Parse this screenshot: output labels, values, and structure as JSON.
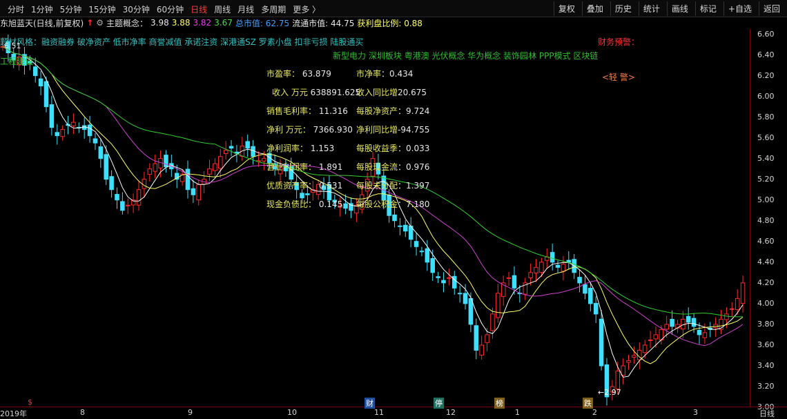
{
  "toolbar": {
    "tabs": [
      "分时",
      "1分钟",
      "5分钟",
      "15分钟",
      "30分钟",
      "60分钟",
      "日线",
      "周线",
      "月线",
      "多周期",
      "更多 〉"
    ],
    "active_tab": "日线",
    "tools": [
      "复权",
      "叠加",
      "历史",
      "统计",
      "画线",
      "标记",
      "+自选",
      "返回"
    ]
  },
  "info": {
    "stock_name": "东旭蓝天(日线,前复权)",
    "theme_label": "主题概念：",
    "v1": "3.98",
    "v2": "3.88",
    "v3": "3.82",
    "v4": "3.67",
    "total_mv_label": "总市值: 62.75",
    "float_mv_label": "流通市值: 44.75",
    "profit_ratio_label": "获利盘比例: 0.88"
  },
  "concepts_line1": "融资融券 破净资产 低市净率 商誉减值 承诺注资 深港通SZ 罗素小盘 扣非亏损 陆股通买",
  "concepts_line1_prefix": "题材风格：",
  "concepts_line2": "新型电力 深圳板块 粤港澳 光伏概念 华为概念 装饰园林 PPP模式 区块链",
  "left_labels": [
    "6.51",
    "工程建设"
  ],
  "warning_title": "财务预警：",
  "warning_level": "<轻 警>",
  "fundamentals": [
    {
      "k1": "市盈率：",
      "v1": "63.879",
      "k2": "市净率",
      "v2": "：0.434"
    },
    {
      "k1": "收入 万元",
      "v1": "638891.625",
      "k2": "收入同比增",
      "v2": "20.675"
    },
    {
      "k1": "销售毛利率：",
      "v1": "11.316",
      "k2": "每股净资产",
      "v2": "：9.724"
    },
    {
      "k1": "净利 万元：",
      "v1": "7366.930",
      "k2": "净利同比增",
      "v2": "-94.755"
    },
    {
      "k1": "净利润率：",
      "v1": "1.153",
      "k2": "每股收益季",
      "v2": "：0.033"
    },
    {
      "k1": "营业利润率：",
      "v1": "1.891",
      "k2": "每股现金流",
      "v2": "：0.976"
    },
    {
      "k1": "优质资产率：",
      "v1": "0.531",
      "k2": "每股未分配",
      "v2": "：1.397"
    },
    {
      "k1": "现金负债比：",
      "v1": "0.145",
      "k2": "每股公积金",
      "v2": "：7.180"
    }
  ],
  "y_axis": [
    "6.60",
    "6.40",
    "6.20",
    "6.00",
    "5.80",
    "5.60",
    "5.40",
    "5.20",
    "5.00",
    "4.80",
    "4.60",
    "4.40",
    "4.20",
    "4.00",
    "3.80",
    "3.60",
    "3.40",
    "3.20",
    "3.00"
  ],
  "x_axis": [
    "2019年",
    "8",
    "9",
    "10",
    "11",
    "12",
    "1",
    "2",
    "3",
    "日线"
  ],
  "low_label": "2.97",
  "bottom_markers": [
    "$",
    "财",
    "停",
    "榜",
    "跌"
  ],
  "colors": {
    "up": "#ff2a2a",
    "down": "#3fe0ff",
    "ma5": "#ffffff",
    "ma10": "#ffff66",
    "ma20": "#d040d0",
    "ma60": "#30d030"
  },
  "chart_data": {
    "type": "candlestick",
    "ylim": [
      3.0,
      6.65
    ],
    "x_labels": [
      "2019年",
      "8",
      "9",
      "10",
      "11",
      "12",
      "1",
      "2",
      "3"
    ],
    "closes": [
      6.48,
      6.42,
      6.35,
      6.38,
      6.3,
      6.32,
      6.2,
      6.1,
      5.9,
      5.7,
      5.62,
      5.68,
      5.72,
      5.75,
      5.7,
      5.68,
      5.62,
      5.55,
      5.4,
      5.2,
      5.1,
      5.0,
      4.9,
      4.95,
      5.0,
      5.1,
      5.2,
      5.3,
      5.35,
      5.4,
      5.32,
      5.3,
      5.2,
      5.25,
      5.1,
      5.05,
      5.15,
      5.2,
      5.3,
      5.35,
      5.42,
      5.48,
      5.5,
      5.45,
      5.52,
      5.5,
      5.42,
      5.38,
      5.4,
      5.36,
      5.3,
      5.32,
      5.28,
      5.2,
      5.1,
      5.02,
      5.05,
      5.1,
      5.15,
      5.1,
      5.0,
      4.98,
      4.95,
      4.92,
      4.9,
      4.95,
      5.05,
      5.2,
      5.4,
      5.25,
      5.0,
      4.85,
      4.8,
      4.75,
      4.7,
      4.62,
      4.55,
      4.5,
      4.4,
      4.3,
      4.25,
      4.2,
      4.25,
      4.15,
      4.1,
      4.0,
      3.8,
      3.55,
      3.6,
      3.7,
      3.9,
      4.1,
      4.2,
      4.25,
      4.15,
      4.1,
      4.2,
      4.3,
      4.35,
      4.4,
      4.45,
      4.4,
      4.35,
      4.38,
      4.4,
      4.3,
      4.2,
      4.1,
      4.0,
      3.9,
      3.4,
      3.1,
      3.2,
      3.35,
      3.4,
      3.45,
      3.5,
      3.55,
      3.6,
      3.65,
      3.7,
      3.75,
      3.8,
      3.78,
      3.8,
      3.85,
      3.82,
      3.78,
      3.7,
      3.72,
      3.75,
      3.8,
      3.85,
      3.9,
      3.95,
      4.05,
      4.2
    ]
  }
}
